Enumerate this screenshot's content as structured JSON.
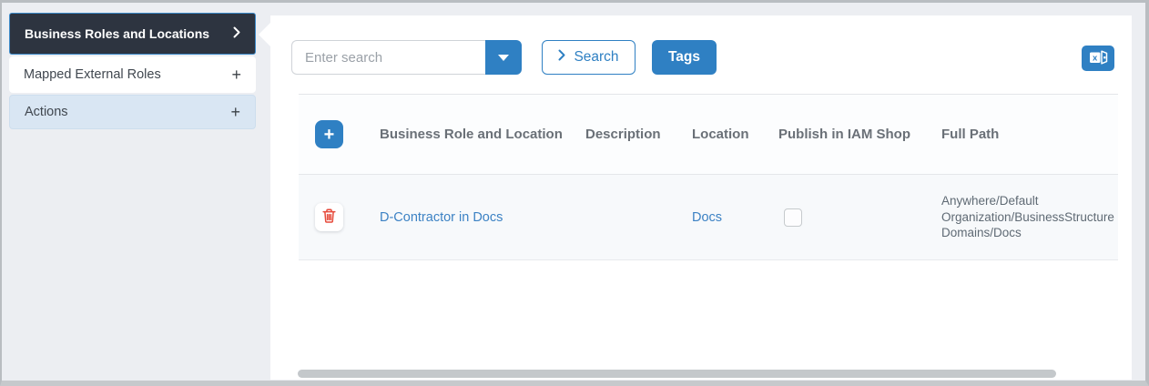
{
  "sidebar": {
    "items": [
      {
        "label": "Business Roles and Locations",
        "icon": "chevron-right-icon",
        "active": true
      },
      {
        "label": "Mapped External Roles",
        "icon": "plus-icon",
        "active": false
      },
      {
        "label": "Actions",
        "icon": "plus-icon",
        "active": false
      }
    ]
  },
  "toolbar": {
    "search_placeholder": "Enter search",
    "search_value": "",
    "search_button_label": "Search",
    "tags_button_label": "Tags",
    "export_icon": "excel-export-icon"
  },
  "table": {
    "columns": [
      "Business Role and Location",
      "Description",
      "Location",
      "Publish in IAM Shop",
      "Full Path"
    ],
    "rows": [
      {
        "business_role": "D-Contractor in Docs",
        "description": "",
        "location": "Docs",
        "publish_in_iam_shop": false,
        "full_path": "Anywhere/Default Organization/BusinessStructure Domains/Docs"
      }
    ]
  },
  "icons": {
    "plus_glyph": "+"
  },
  "colors": {
    "accent_blue": "#2f80c3",
    "active_item_bg": "#2d3440",
    "active_item_border": "#3d8ac9",
    "link_blue": "#3c82c4",
    "danger_red": "#e64a3b",
    "sidebar_bg": "#eceef2",
    "row_bg": "#f7f9fb"
  }
}
